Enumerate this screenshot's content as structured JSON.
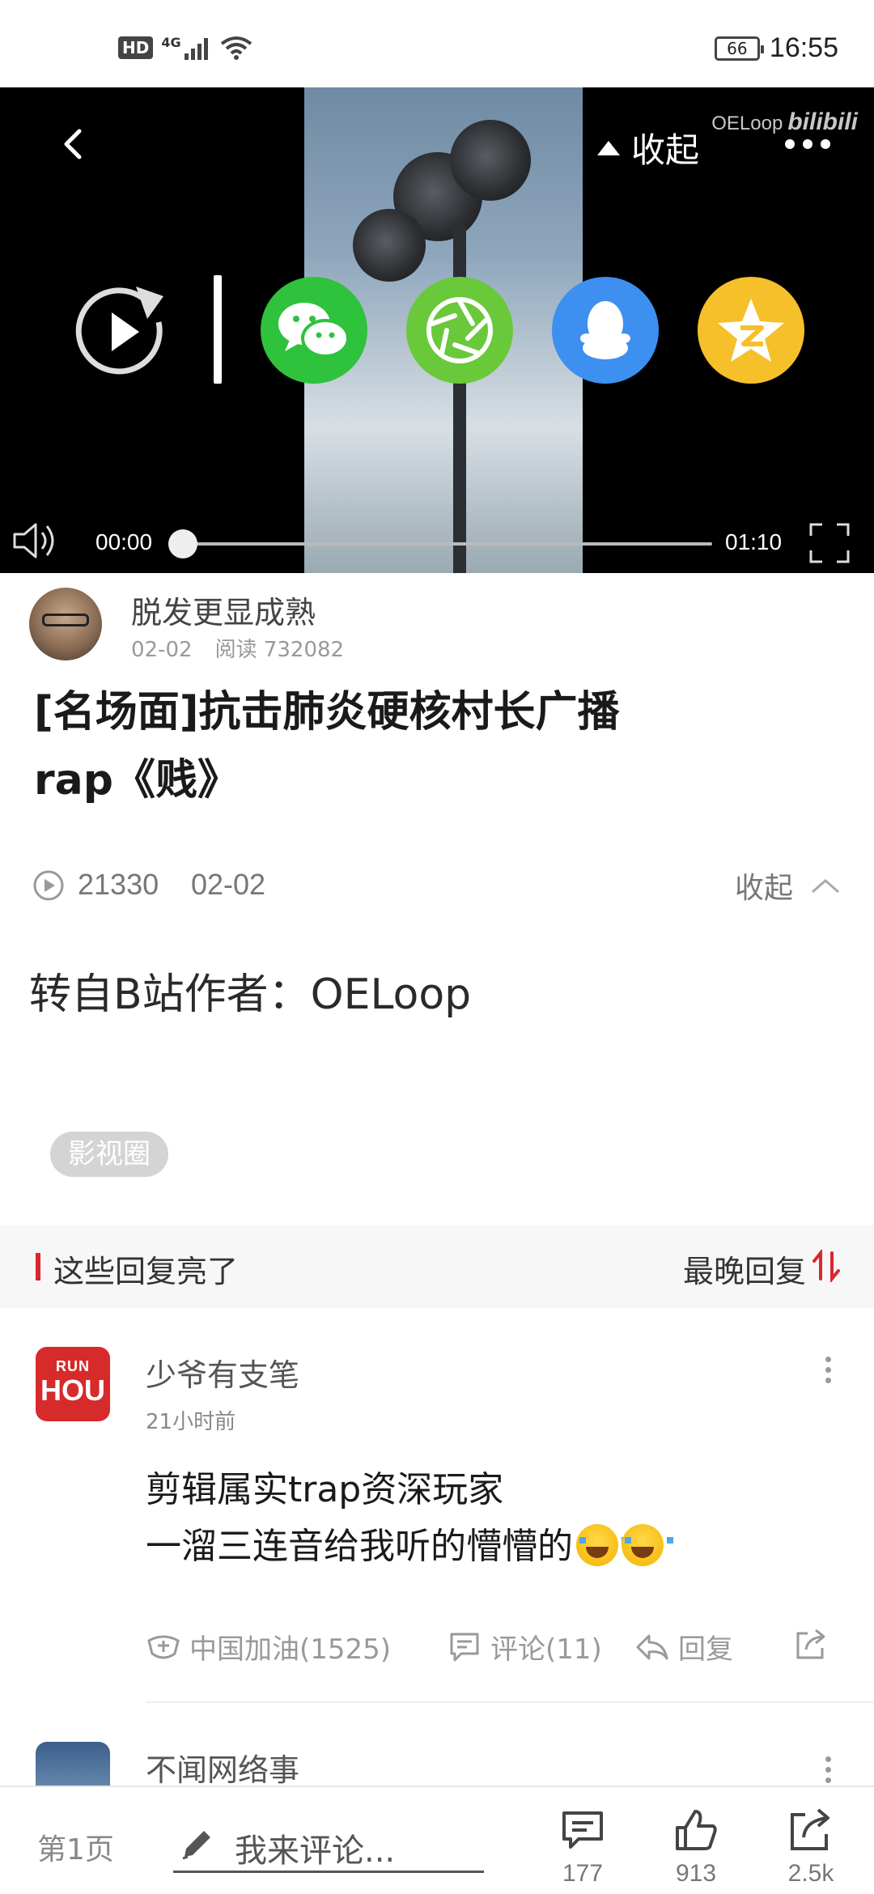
{
  "status_bar": {
    "hd": "HD",
    "network": "4G",
    "battery": "66",
    "time": "16:55"
  },
  "video": {
    "collapse_label": "收起",
    "watermark_channel": "OELoop",
    "watermark_brand": "bilibili",
    "current_time": "00:00",
    "total_time": "01:10",
    "progress": 0,
    "share_targets": [
      "wechat",
      "wechat-moments",
      "qq",
      "qzone"
    ]
  },
  "author": {
    "name": "脱发更显成熟",
    "date": "02-02",
    "views": "阅读 732082"
  },
  "post": {
    "title_line1": "[名场面]抗击肺炎硬核村长广播",
    "title_line2": "rap《贱》",
    "play_count": "21330",
    "play_date": "02-02",
    "collapse_label": "收起",
    "description": "转自B站作者：OELoop",
    "tag": "影视圈"
  },
  "replies_header": {
    "title": "这些回复亮了",
    "sort_label": "最晚回复"
  },
  "comments": [
    {
      "avatar_line1": "RUN",
      "avatar_line2": "HOU",
      "name": "少爷有支笔",
      "time": "21小时前",
      "line1": "剪辑属实trap资深玩家",
      "line2": "一溜三连音给我听的懵懵的",
      "support": "中国加油(1525)",
      "comments": "评论(11)",
      "reply": "回复"
    },
    {
      "name": "不闻网络事"
    }
  ],
  "bottom_bar": {
    "page": "第1页",
    "input_placeholder": "我来评论...",
    "comment_count": "177",
    "like_count": "913",
    "share_count": "2.5k"
  },
  "colors": {
    "accent": "#d8272f",
    "wechat": "#2fc23d",
    "moments": "#69c93a",
    "qq": "#3d8ff0",
    "qzone": "#f6c02a"
  }
}
